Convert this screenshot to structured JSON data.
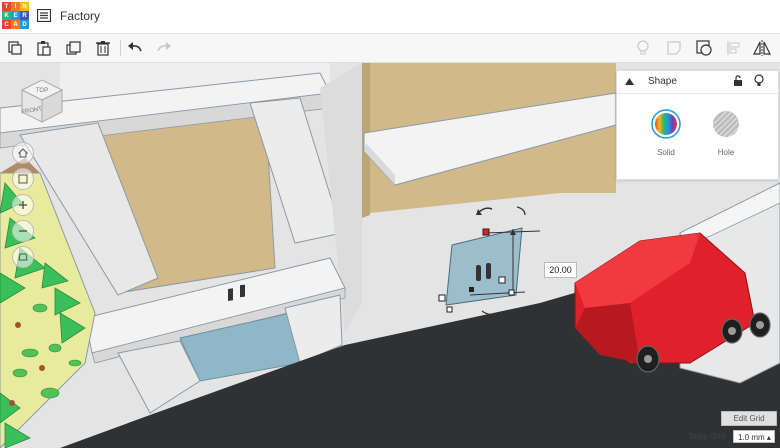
{
  "app": {
    "logo_letters": [
      "T",
      "I",
      "N",
      "K",
      "E",
      "R",
      "C",
      "A",
      "D"
    ],
    "logo_colors": [
      "#e8432d",
      "#f37a23",
      "#f5b80d",
      "#2ab67b",
      "#1e9ad6",
      "#3a5ab9",
      "#e8432d",
      "#f37a23",
      "#1e9ad6"
    ],
    "design_title": "Factory"
  },
  "toolbar": {
    "items": [
      "copy-icon",
      "paste-icon",
      "duplicate-icon",
      "delete-icon",
      "undo-icon",
      "redo-icon"
    ],
    "right_items": [
      "light-bulb-icon",
      "note-icon",
      "workplane-icon",
      "align-icon",
      "mirror-icon"
    ]
  },
  "viewcube": {
    "top_label": "TOP",
    "front_label": "FRONT"
  },
  "nav_controls": [
    "home-icon",
    "fit-icon",
    "zoom-in-icon",
    "zoom-out-icon",
    "perspective-icon"
  ],
  "inspector": {
    "title": "Shape",
    "solid_label": "Solid",
    "hole_label": "Hole",
    "icons": [
      "collapse-arrow-icon",
      "lock-icon",
      "light-bulb-icon"
    ]
  },
  "selection": {
    "dimension_value": "20.00"
  },
  "grid": {
    "edit_label": "Edit Grid",
    "snap_label": "Snap Grid",
    "snap_value": "1.0 mm ▴"
  },
  "colors": {
    "accent": "#1e9ad6",
    "truck_red": "#e0202a",
    "glass": "#8fb7c8",
    "road": "#2f3133",
    "wall": "#e3e3e3"
  }
}
